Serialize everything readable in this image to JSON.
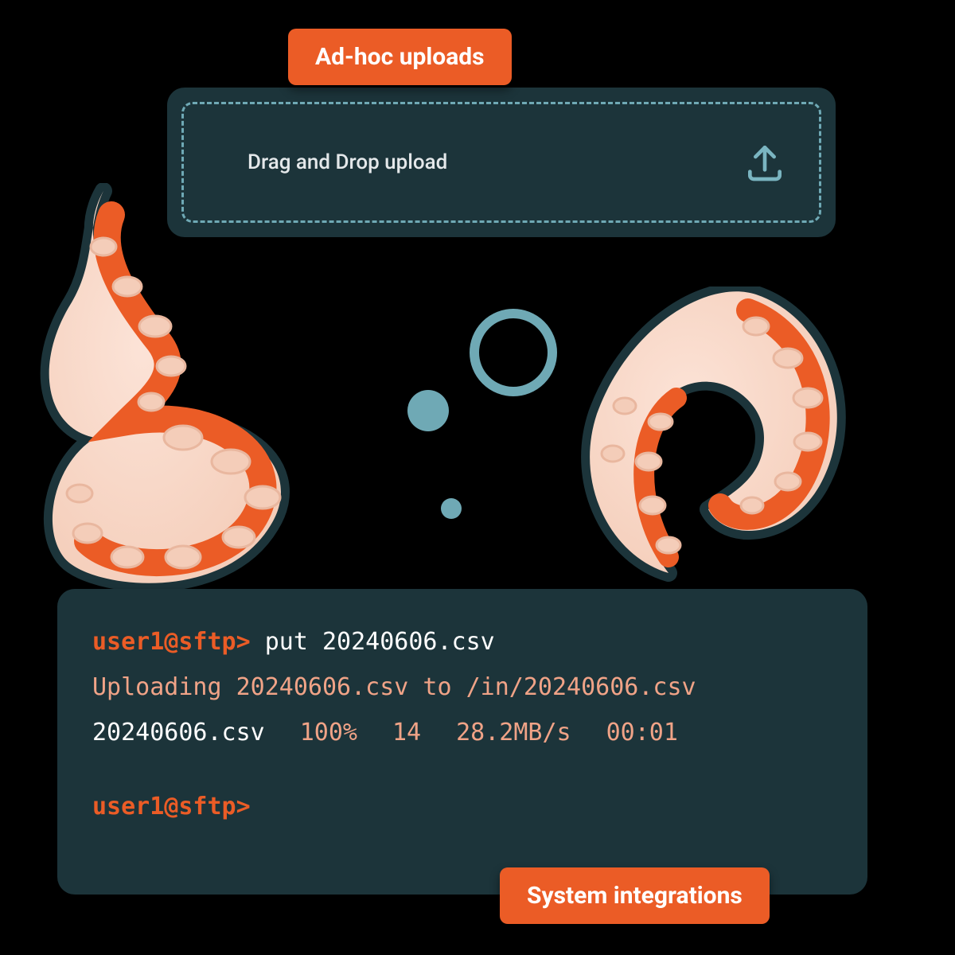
{
  "chips": {
    "adhoc": "Ad-hoc uploads",
    "integrations": "System integrations"
  },
  "dropzone": {
    "label": "Drag and Drop upload",
    "icon": "upload-icon"
  },
  "terminal": {
    "prompt": "user1@sftp>",
    "command": "put 20240606.csv",
    "uploading_msg": "Uploading 20240606.csv to /in/20240606.csv",
    "stats": {
      "file": "20240606.csv",
      "percent": "100%",
      "bytes": "14",
      "rate": "28.2MB/s",
      "eta": "00:01"
    }
  },
  "colors": {
    "panel": "#1c343a",
    "accent": "#eb5c26",
    "dash": "#6fa9b5",
    "msg": "#f0a387"
  }
}
